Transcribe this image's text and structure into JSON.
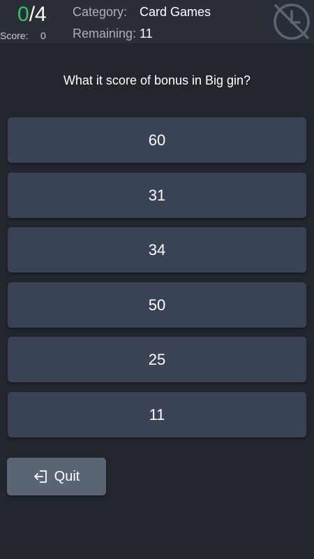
{
  "header": {
    "progress_current": "0",
    "progress_separator": "/",
    "progress_total": "4",
    "score_label": "Score:",
    "score_value": "0",
    "category_label": "Category:",
    "category_value": "Card Games",
    "remaining_label": "Remaining:",
    "remaining_value": "11",
    "timer_icon": "timer-off-icon"
  },
  "question": {
    "text": "What it score of bonus in Big gin?"
  },
  "answers": [
    {
      "label": "60"
    },
    {
      "label": "31"
    },
    {
      "label": "34"
    },
    {
      "label": "50"
    },
    {
      "label": "25"
    },
    {
      "label": "11"
    }
  ],
  "quit": {
    "label": "Quit",
    "icon": "exit-icon"
  },
  "colors": {
    "background": "#22262d",
    "header_background": "#2a2e37",
    "answer_button": "#3a4356",
    "quit_button": "#5a6474",
    "progress_current": "#3fbf6e"
  }
}
